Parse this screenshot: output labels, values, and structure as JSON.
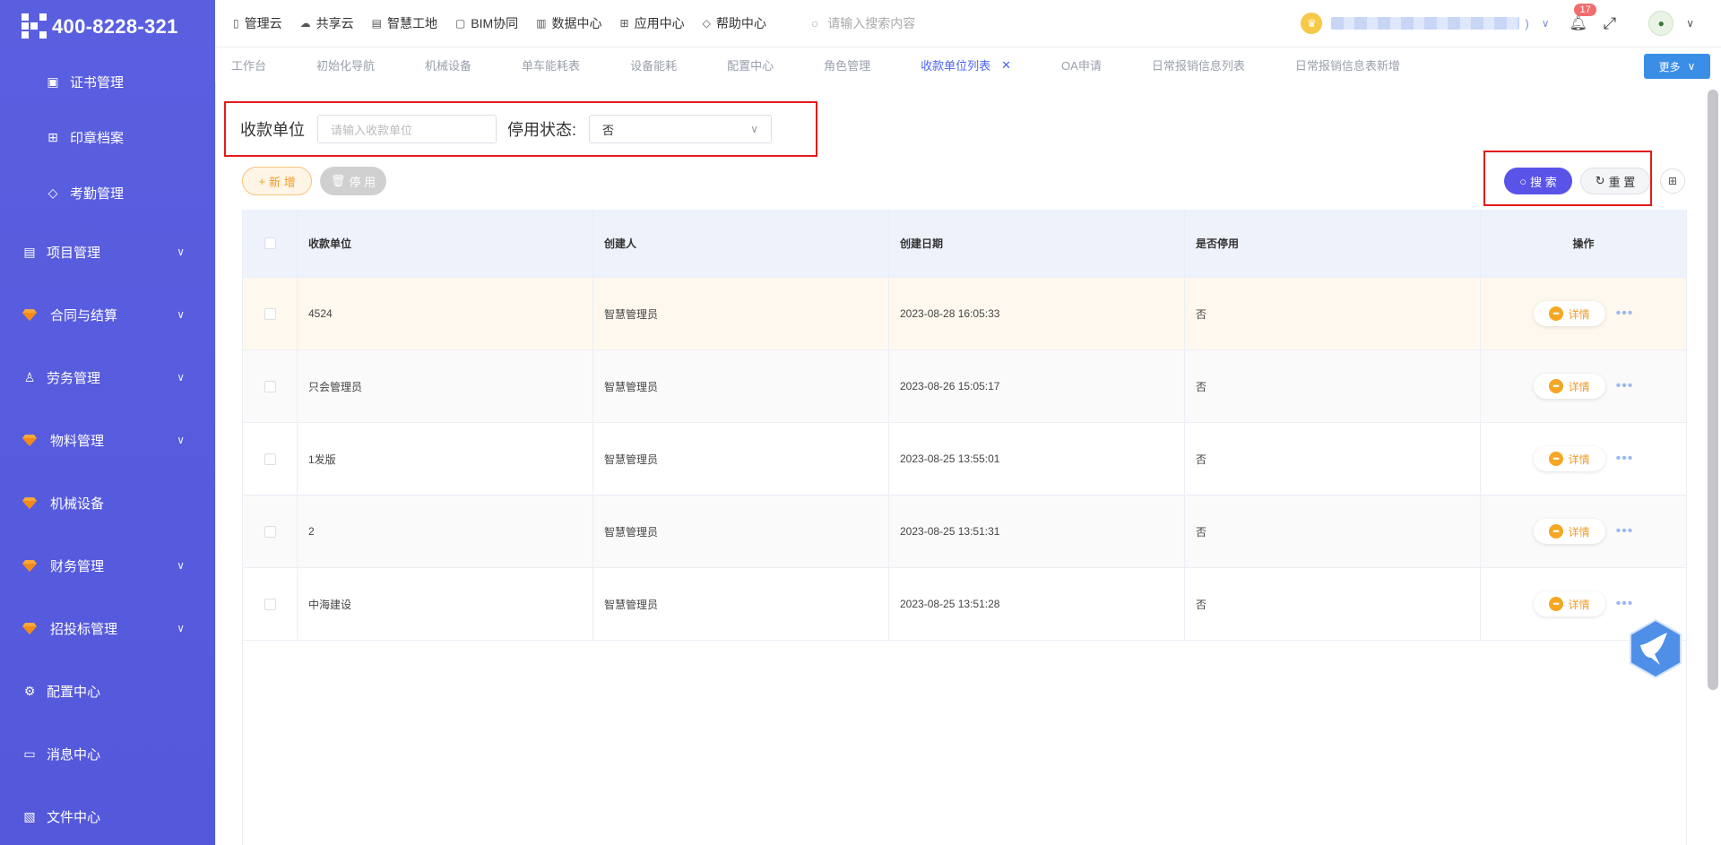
{
  "logo": {
    "text": "400-8228-321"
  },
  "sidebar": {
    "subitems": [
      {
        "label": "证书管理",
        "icon": "certificate-icon"
      },
      {
        "label": "印章档案",
        "icon": "grid-icon"
      },
      {
        "label": "考勤管理",
        "icon": "tag-icon"
      }
    ],
    "items": [
      {
        "label": "项目管理",
        "icon": "book-icon",
        "expandable": true
      },
      {
        "label": "合同与结算",
        "icon": "gem-icon",
        "expandable": true
      },
      {
        "label": "劳务管理",
        "icon": "user-icon",
        "expandable": true
      },
      {
        "label": "物料管理",
        "icon": "gem-icon",
        "expandable": true
      },
      {
        "label": "机械设备",
        "icon": "gem-icon",
        "expandable": false
      },
      {
        "label": "财务管理",
        "icon": "gem-icon",
        "expandable": true
      },
      {
        "label": "招投标管理",
        "icon": "gem-icon",
        "expandable": true
      },
      {
        "label": "配置中心",
        "icon": "gear-icon",
        "expandable": false
      },
      {
        "label": "消息中心",
        "icon": "message-icon",
        "expandable": false
      },
      {
        "label": "文件中心",
        "icon": "file-icon",
        "expandable": false
      }
    ]
  },
  "topnav": {
    "items": [
      "管理云",
      "共享云",
      "智慧工地",
      "BIM协同",
      "数据中心",
      "应用中心",
      "帮助中心"
    ],
    "search_placeholder": "请输入搜索内容",
    "username_tail": ")",
    "notification_count": "17"
  },
  "tabs": {
    "items": [
      "工作台",
      "初始化导航",
      "机械设备",
      "单车能耗表",
      "设备能耗",
      "配置中心",
      "角色管理",
      "收款单位列表",
      "OA申请",
      "日常报销信息列表",
      "日常报销信息表新增"
    ],
    "active": "收款单位列表",
    "more_label": "更多"
  },
  "filter": {
    "unit_label": "收款单位",
    "unit_placeholder": "请输入收款单位",
    "status_label": "停用状态:",
    "status_value": "否"
  },
  "actions": {
    "add_label": "新 增",
    "disable_label": "停 用",
    "search_label": "搜 索",
    "reset_label": "重 置"
  },
  "table": {
    "headers": [
      "收款单位",
      "创建人",
      "创建日期",
      "是否停用",
      "操作"
    ],
    "detail_label": "详情",
    "rows": [
      {
        "unit": "4524",
        "creator": "智慧管理员",
        "date": "2023-08-28 16:05:33",
        "disabled": "否"
      },
      {
        "unit": "只会管理员",
        "creator": "智慧管理员",
        "date": "2023-08-26 15:05:17",
        "disabled": "否"
      },
      {
        "unit": "1发版",
        "creator": "智慧管理员",
        "date": "2023-08-25 13:55:01",
        "disabled": "否"
      },
      {
        "unit": "2",
        "creator": "智慧管理员",
        "date": "2023-08-25 13:51:31",
        "disabled": "否"
      },
      {
        "unit": "中海建设",
        "creator": "智慧管理员",
        "date": "2023-08-25 13:51:28",
        "disabled": "否"
      }
    ]
  }
}
